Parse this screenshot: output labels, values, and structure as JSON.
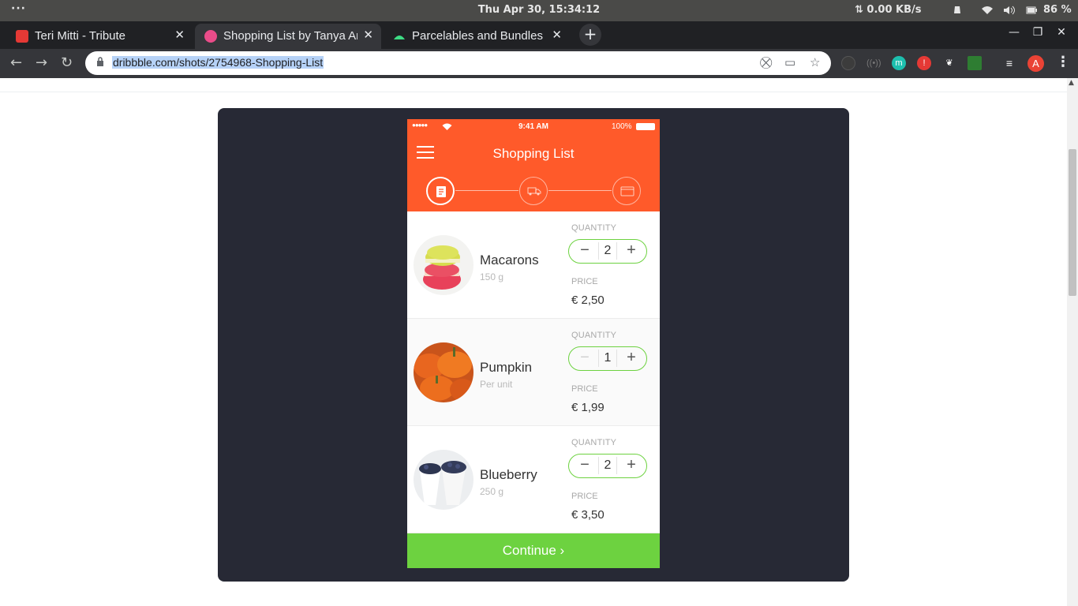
{
  "system": {
    "menu_dots": "···",
    "clock": "Thu Apr 30, 15:34:12",
    "net_speed": "⇅ 0.00 KB/s",
    "battery": "86 %"
  },
  "tabs": [
    {
      "title": "Teri Mitti - Tribute",
      "favicon_color": "#e53935",
      "active": false
    },
    {
      "title": "Shopping List by Tanya Ar",
      "favicon_color": "#ea4c89",
      "active": true
    },
    {
      "title": "Parcelables and Bundles",
      "favicon_color": "#3ddc84",
      "active": false
    }
  ],
  "toolbar": {
    "url": "dribbble.com/shots/2754968-Shopping-List",
    "avatar_letter": "A"
  },
  "phone": {
    "status": {
      "time": "9:41 AM",
      "battery": "100%"
    },
    "title": "Shopping List",
    "items": [
      {
        "name": "Macarons",
        "unit": "150 g",
        "quantity_label": "QUANTITY",
        "quantity": "2",
        "price_label": "PRICE",
        "price": "€ 2,50",
        "minus_enabled": true
      },
      {
        "name": "Pumpkin",
        "unit": "Per unit",
        "quantity_label": "QUANTITY",
        "quantity": "1",
        "price_label": "PRICE",
        "price": "€ 1,99",
        "minus_enabled": false
      },
      {
        "name": "Blueberry",
        "unit": "250 g",
        "quantity_label": "QUANTITY",
        "quantity": "2",
        "price_label": "PRICE",
        "price": "€ 3,50",
        "minus_enabled": true
      }
    ],
    "continue_label": "Continue ›",
    "colors": {
      "header": "#ff5a2a",
      "accent": "#6dd240",
      "frame": "#272935"
    }
  }
}
